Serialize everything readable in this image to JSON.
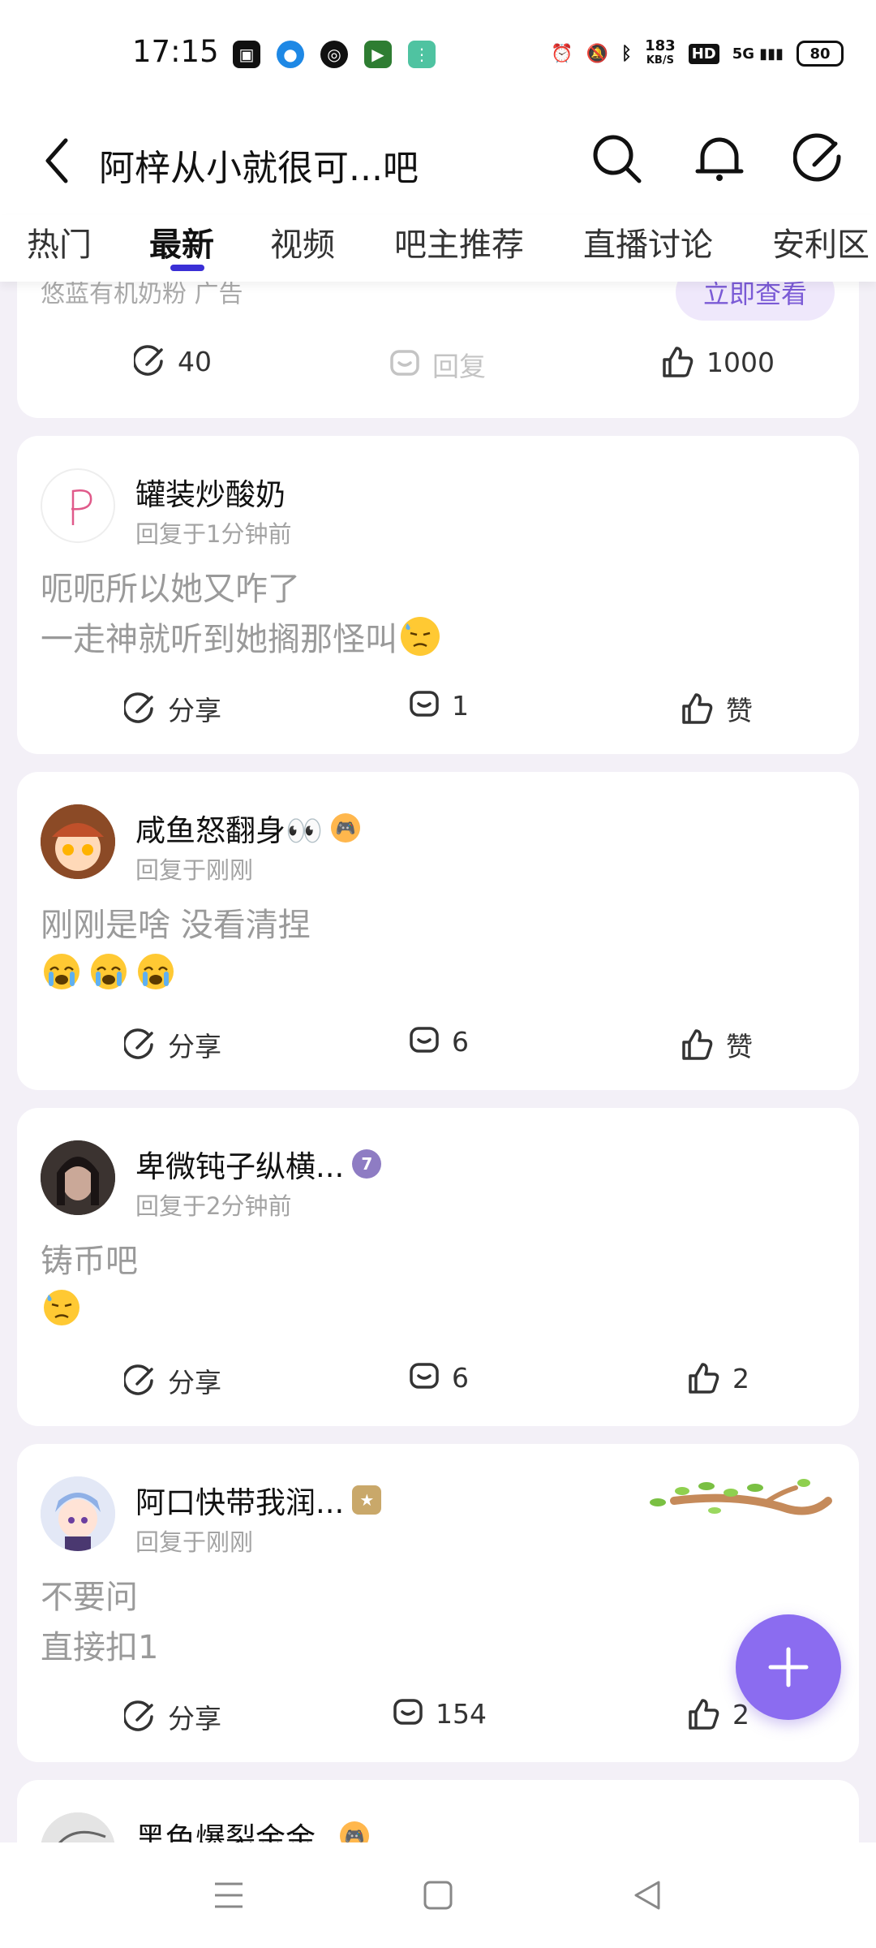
{
  "status_bar": {
    "time": "17:15",
    "network_speed_value": "183",
    "network_speed_unit": "KB/S",
    "hd": "HD",
    "signal": "5G",
    "battery": "80"
  },
  "header": {
    "title": "阿梓从小就很可...吧"
  },
  "tabs": [
    {
      "label": "热门"
    },
    {
      "label": "最新"
    },
    {
      "label": "视频"
    },
    {
      "label": "吧主推荐"
    },
    {
      "label": "直播讨论"
    },
    {
      "label": "安利区"
    }
  ],
  "active_tab": "最新",
  "ad": {
    "source": "悠蓝有机奶粉 广告",
    "cta": "立即查看",
    "share_count": "40",
    "reply_label": "回复",
    "like_count": "1000"
  },
  "posts": [
    {
      "name": "罐装炒酸奶",
      "time": "回复于1分钟前",
      "lines": [
        "呃呃所以她又咋了",
        "一走神就听到她搁那怪叫"
      ],
      "share_label": "分享",
      "comments": "1",
      "likes": "赞"
    },
    {
      "name": "咸鱼怒翻身👀",
      "time": "回复于刚刚",
      "lines": [
        "刚刚是啥 没看清捏"
      ],
      "share_label": "分享",
      "comments": "6",
      "likes": "赞"
    },
    {
      "name": "卑微钝子纵横...",
      "time": "回复于2分钟前",
      "lines": [
        "铸币吧"
      ],
      "badge": "7",
      "share_label": "分享",
      "comments": "6",
      "likes": "2"
    },
    {
      "name": "阿口快带我润...",
      "time": "回复于刚刚",
      "lines": [
        "不要问",
        "直接扣1"
      ],
      "share_label": "分享",
      "comments": "154",
      "likes": "2"
    },
    {
      "name": "黑色爆裂金金"
    }
  ],
  "colors": {
    "accent": "#3a2fd6",
    "fab": "#8b6cf0",
    "page_bg": "#f3f0f7"
  }
}
